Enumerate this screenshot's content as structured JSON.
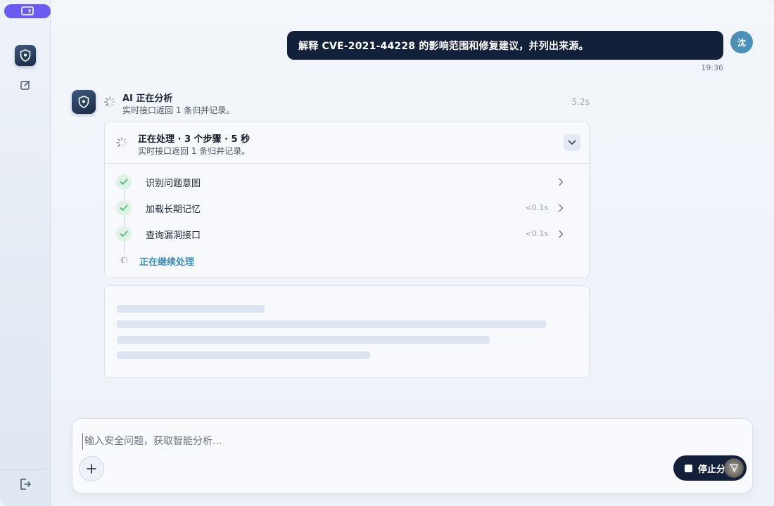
{
  "colors": {
    "accent": "#6a5cf0",
    "dark_navy": "#13203a",
    "link_blue": "#3a8fc0",
    "success_bg": "#dff3e4",
    "success": "#3cb371",
    "avatar_blue": "#4a90b8"
  },
  "sidebar": {
    "top_icon": "screen-user-icon",
    "nav_icons": [
      "shield-icon",
      "edit-icon"
    ],
    "bottom_icon": "logout-icon"
  },
  "user_message": {
    "avatar_text": "沈",
    "text": "解释 CVE-2021-44228 的影响范围和修复建议，并列出来源。",
    "time": "19:36"
  },
  "ai": {
    "title": "AI 正在分析",
    "subtitle": "实时接口返回 1 条归并记录。",
    "elapsed": "5.2s"
  },
  "process": {
    "title": "正在处理 · 3 个步骤 · 5 秒",
    "subtitle": "实时接口返回 1 条归并记录。",
    "steps": [
      {
        "label": "识别问题意图",
        "time": ""
      },
      {
        "label": "加载长期记忆",
        "time": "<0.1s"
      },
      {
        "label": "查询漏洞接口",
        "time": "<0.1s"
      }
    ],
    "continuing_label": "正在继续处理"
  },
  "composer": {
    "placeholder": "输入安全问题，获取智能分析...",
    "value": "",
    "stop_label": "停止分析"
  }
}
